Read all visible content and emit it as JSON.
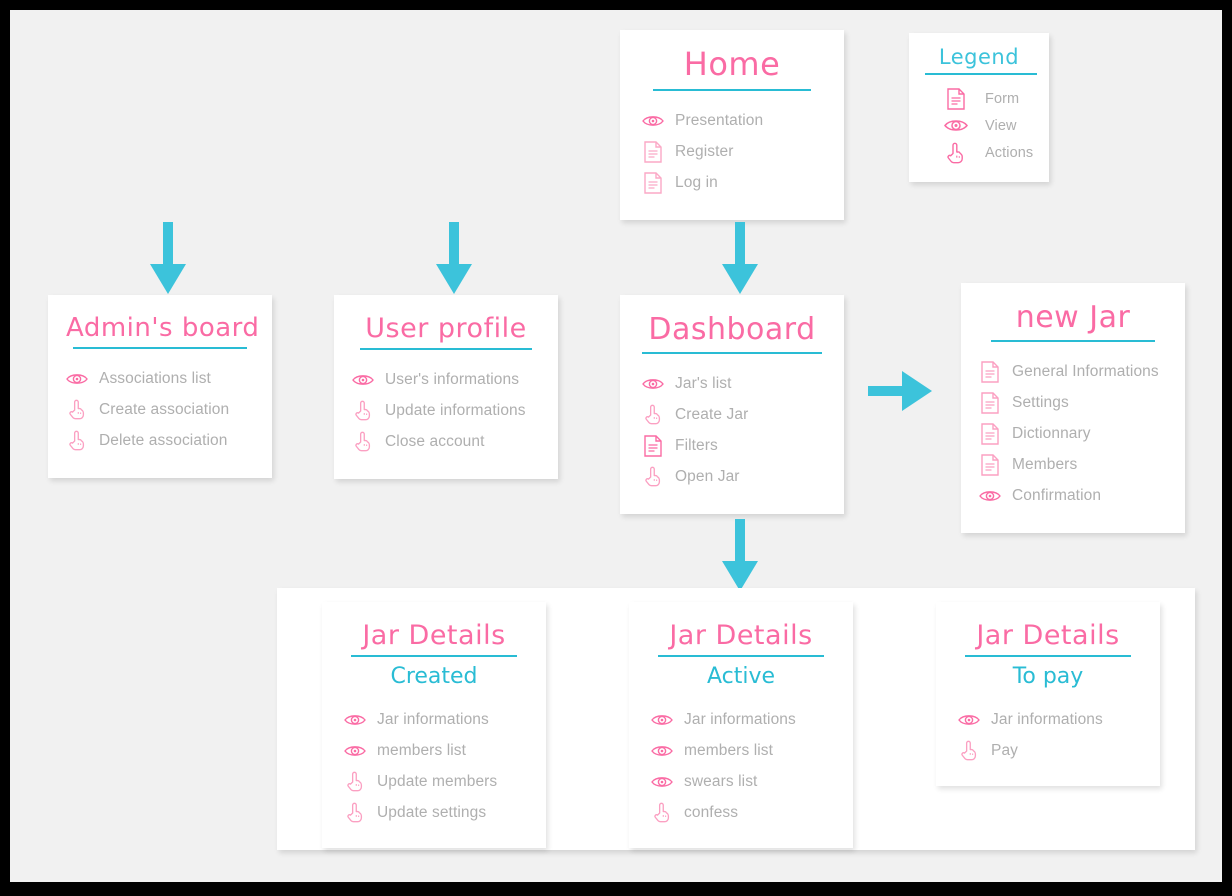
{
  "meta": {
    "canvas_bg": "#F1F1F1",
    "frame_color": "#000000",
    "pink": "#FA6BA4",
    "cyan": "#29BCD4",
    "arrow_color": "#3CC3DB",
    "label_gray": "#AFAFAF"
  },
  "legend": {
    "title": "Legend",
    "items": [
      {
        "icon": "form-icon",
        "label": "Form"
      },
      {
        "icon": "view-icon",
        "label": "View"
      },
      {
        "icon": "actions-icon",
        "label": "Actions"
      }
    ]
  },
  "home": {
    "title": "Home",
    "items": [
      {
        "icon": "view-icon",
        "label": "Presentation"
      },
      {
        "icon": "form-icon",
        "label": "Register"
      },
      {
        "icon": "form-icon",
        "label": "Log in"
      }
    ]
  },
  "admin_board": {
    "title": "Admin's board",
    "items": [
      {
        "icon": "view-icon",
        "label": "Associations list"
      },
      {
        "icon": "actions-icon",
        "label": "Create association"
      },
      {
        "icon": "actions-icon",
        "label": "Delete association"
      }
    ]
  },
  "user_profile": {
    "title": "User profile",
    "items": [
      {
        "icon": "view-icon",
        "label": "User's informations"
      },
      {
        "icon": "actions-icon",
        "label": "Update informations"
      },
      {
        "icon": "actions-icon",
        "label": "Close account"
      }
    ]
  },
  "dashboard": {
    "title": "Dashboard",
    "items": [
      {
        "icon": "view-icon",
        "label": "Jar's list"
      },
      {
        "icon": "actions-icon",
        "label": "Create Jar"
      },
      {
        "icon": "form-icon",
        "label": "Filters"
      },
      {
        "icon": "actions-icon",
        "label": "Open Jar"
      }
    ]
  },
  "new_jar": {
    "title": "new Jar",
    "items": [
      {
        "icon": "form-icon",
        "label": "General Informations"
      },
      {
        "icon": "form-icon",
        "label": "Settings"
      },
      {
        "icon": "form-icon",
        "label": "Dictionnary"
      },
      {
        "icon": "form-icon",
        "label": "Members"
      },
      {
        "icon": "view-icon",
        "label": "Confirmation"
      }
    ]
  },
  "jar_details_created": {
    "title": "Jar Details",
    "subtitle": "Created",
    "items": [
      {
        "icon": "view-icon",
        "label": "Jar informations"
      },
      {
        "icon": "view-icon",
        "label": "members list"
      },
      {
        "icon": "actions-icon",
        "label": "Update members"
      },
      {
        "icon": "actions-icon",
        "label": "Update settings"
      }
    ]
  },
  "jar_details_active": {
    "title": "Jar Details",
    "subtitle": "Active",
    "items": [
      {
        "icon": "view-icon",
        "label": "Jar informations"
      },
      {
        "icon": "view-icon",
        "label": "members list"
      },
      {
        "icon": "view-icon",
        "label": "swears list"
      },
      {
        "icon": "actions-icon",
        "label": "confess"
      }
    ]
  },
  "jar_details_topay": {
    "title": "Jar Details",
    "subtitle": "To pay",
    "items": [
      {
        "icon": "view-icon",
        "label": "Jar informations"
      },
      {
        "icon": "actions-icon",
        "label": "Pay"
      }
    ]
  },
  "arrows": [
    {
      "name": "arrow-home-to-admin",
      "direction": "down"
    },
    {
      "name": "arrow-home-to-user-profile",
      "direction": "down"
    },
    {
      "name": "arrow-home-to-dashboard",
      "direction": "down"
    },
    {
      "name": "arrow-dashboard-to-new-jar",
      "direction": "right"
    },
    {
      "name": "arrow-dashboard-to-jar-details",
      "direction": "down"
    }
  ]
}
